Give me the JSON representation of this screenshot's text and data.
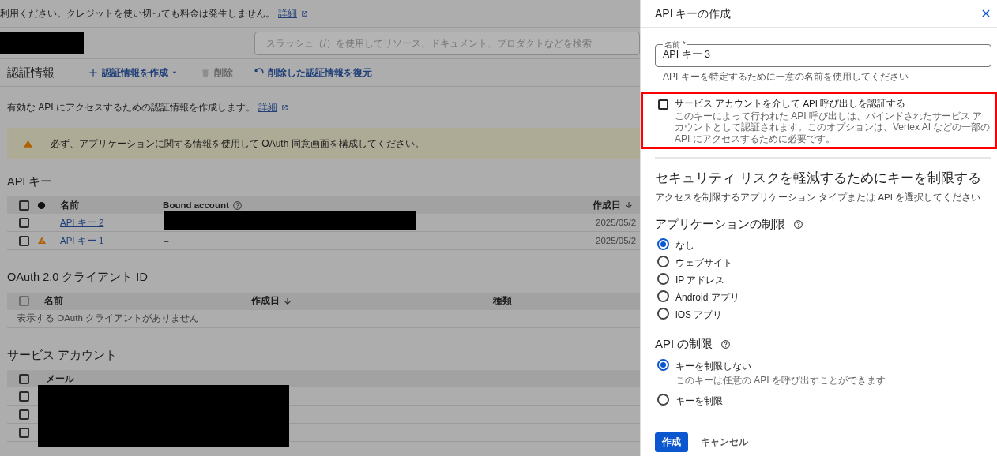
{
  "background_page": {
    "notice": {
      "text": "利用ください。クレジットを使い切っても料金は発生しません。",
      "link": "詳細"
    },
    "search": {
      "placeholder": "スラッシュ（/）を使用してリソース、ドキュメント、プロダクトなどを検索"
    },
    "toolbar": {
      "title": "認証情報",
      "actions": [
        {
          "label": "認証情報を作成",
          "kind": "create",
          "disabled": false
        },
        {
          "label": "削除",
          "kind": "delete",
          "disabled": true
        },
        {
          "label": "削除した認証情報を復元",
          "kind": "restore",
          "disabled": false
        }
      ]
    },
    "intro": {
      "text": "有効な API にアクセスするための認証情報を作成します。",
      "link": "詳細"
    },
    "warning": "必ず、アプリケーションに関する情報を使用して OAuth 同意画面を構成してください。",
    "api_keys": {
      "title": "API キー",
      "select_all": {
        "checked": false
      },
      "columns": [
        {
          "label": "名前",
          "kind": "plain"
        },
        {
          "label": "Bound account",
          "kind": "help"
        },
        {
          "label": "作成日",
          "kind": "sortable"
        }
      ],
      "rows": [
        {
          "name": "API キー 2",
          "warning": false,
          "bound_account": "",
          "redacted": true,
          "date": "2025/05/2",
          "checked": false
        },
        {
          "name": "API キー 1",
          "warning": true,
          "bound_account": "–",
          "redacted": false,
          "date": "2025/05/2",
          "checked": false
        }
      ]
    },
    "oauth": {
      "title": "OAuth 2.0 クライアント ID",
      "select_all": {
        "checked": false
      },
      "columns": [
        {
          "label": "名前",
          "kind": "plain"
        },
        {
          "label": "作成日",
          "kind": "sortable"
        },
        {
          "label": "種類",
          "kind": "plain"
        }
      ],
      "empty": "表示する OAuth クライアントがありません"
    },
    "service_accounts": {
      "title": "サービス アカウント",
      "select_all": {
        "checked": false
      },
      "columns": [
        {
          "label": "メール"
        }
      ],
      "rows": [
        {
          "checked": false,
          "redacted": true
        },
        {
          "checked": false,
          "redacted": true
        },
        {
          "checked": false,
          "redacted": true
        }
      ]
    }
  },
  "panel": {
    "title": "API キーの作成",
    "name_field": {
      "label": "名前 *",
      "value": "API キー 3",
      "hint": "API キーを特定するために一意の名前を使用してください"
    },
    "service_account_option": {
      "label": "サービス アカウントを介して API 呼び出しを認証する",
      "description": "このキーによって行われた API 呼び出しは、バインドされたサービス アカウントとして認証されます。このオプションは、Vertex AI などの一部の API にアクセスするために必要です。",
      "checked": false,
      "highlighted": true
    },
    "section_title": "セキュリティ リスクを軽減するためにキーを制限する",
    "section_subtitle": "アクセスを制限するアプリケーション タイプまたは API を選択してください",
    "groups": [
      {
        "title": "アプリケーションの制限",
        "options": [
          {
            "label": "なし",
            "selected": true
          },
          {
            "label": "ウェブサイト",
            "selected": false
          },
          {
            "label": "IP アドレス",
            "selected": false
          },
          {
            "label": "Android アプリ",
            "selected": false
          },
          {
            "label": "iOS アプリ",
            "selected": false
          }
        ]
      },
      {
        "title": "API の制限",
        "options": [
          {
            "label": "キーを制限しない",
            "description": "このキーは任意の API を呼び出すことができます",
            "selected": true
          },
          {
            "label": "キーを制限",
            "selected": false
          }
        ]
      }
    ],
    "buttons": [
      {
        "label": "作成",
        "kind": "primary"
      },
      {
        "label": "キャンセル",
        "kind": "text"
      }
    ]
  }
}
